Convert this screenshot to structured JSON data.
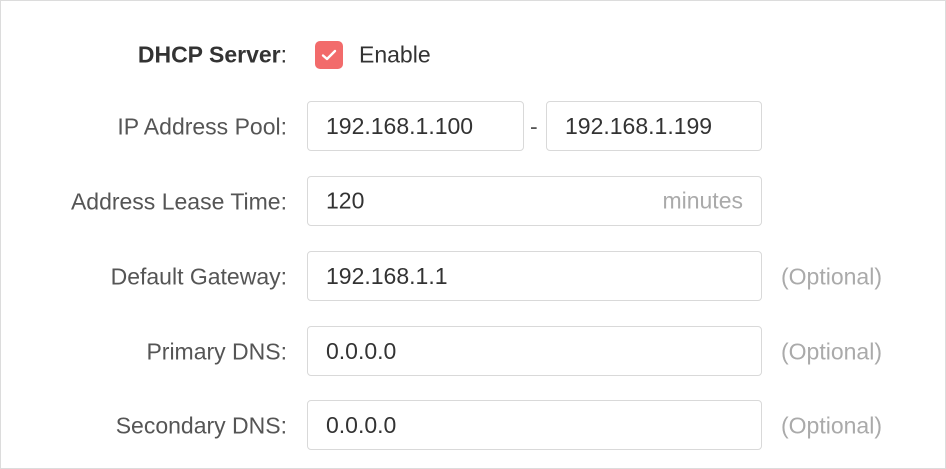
{
  "dhcp": {
    "label": "DHCP Server",
    "colon": ":",
    "enable_label": "Enable",
    "enabled": true
  },
  "pool": {
    "label": "IP Address Pool:",
    "start": "192.168.1.100",
    "separator": "-",
    "end": "192.168.1.199"
  },
  "lease": {
    "label": "Address Lease Time:",
    "value": "120",
    "unit": "minutes"
  },
  "gateway": {
    "label": "Default Gateway:",
    "value": "192.168.1.1",
    "note": "(Optional)"
  },
  "primary_dns": {
    "label": "Primary DNS:",
    "value": "0.0.0.0",
    "note": "(Optional)"
  },
  "secondary_dns": {
    "label": "Secondary DNS:",
    "value": "0.0.0.0",
    "note": "(Optional)"
  },
  "colors": {
    "checkbox": "#f26b6b",
    "border": "#d9d9d9",
    "muted": "#aaaaaa"
  }
}
